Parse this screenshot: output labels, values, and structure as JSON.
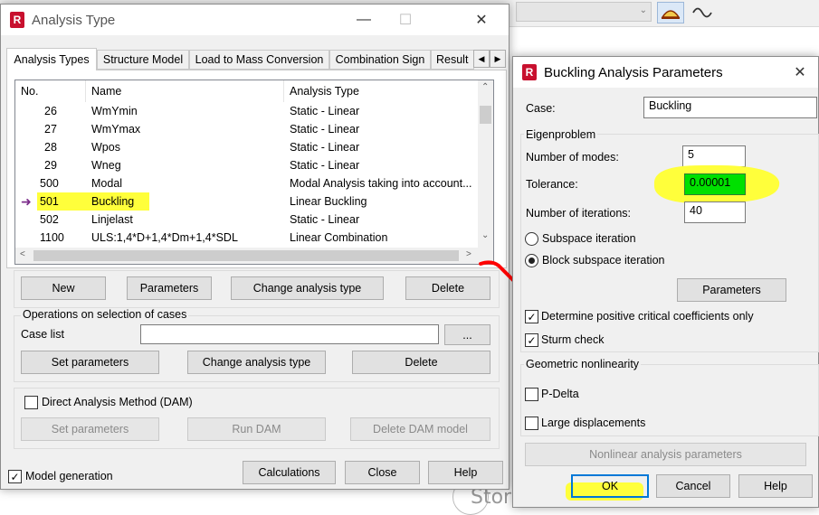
{
  "analysis_window": {
    "title": "Analysis Type",
    "tabs": [
      "Analysis Types",
      "Structure Model",
      "Load to Mass Conversion",
      "Combination Sign",
      "Result"
    ],
    "columns": [
      "No.",
      "Name",
      "Analysis Type"
    ],
    "rows": [
      {
        "no": "26",
        "name": "WmYmin",
        "type": "Static - Linear"
      },
      {
        "no": "27",
        "name": "WmYmax",
        "type": "Static - Linear"
      },
      {
        "no": "28",
        "name": "Wpos",
        "type": "Static - Linear"
      },
      {
        "no": "29",
        "name": "Wneg",
        "type": "Static - Linear"
      },
      {
        "no": "500",
        "name": "Modal",
        "type": "Modal Analysis taking into account..."
      },
      {
        "no": "501",
        "name": "Buckling",
        "type": "Linear Buckling"
      },
      {
        "no": "502",
        "name": "Linjelast",
        "type": "Static - Linear"
      },
      {
        "no": "1100",
        "name": "ULS:1,4*D+1,4*Dm+1,4*SDL",
        "type": "Linear Combination"
      }
    ],
    "selected_row": "501",
    "buttons": {
      "new": "New",
      "parameters": "Parameters",
      "change_type": "Change analysis type",
      "delete": "Delete"
    },
    "operations": {
      "title": "Operations on selection of cases",
      "case_list_label": "Case list",
      "case_list_value": "",
      "browse": "...",
      "set_parameters": "Set parameters",
      "change_type": "Change analysis type",
      "delete": "Delete"
    },
    "dam": {
      "label": "Direct Analysis Method (DAM)",
      "set_parameters": "Set parameters",
      "run": "Run DAM",
      "delete_model": "Delete DAM model"
    },
    "model_generation": "Model generation",
    "footer": {
      "calculations": "Calculations",
      "close": "Close",
      "help": "Help"
    }
  },
  "buckling_window": {
    "title": "Buckling Analysis Parameters",
    "case_label": "Case:",
    "case_value": "Buckling",
    "eigen_title": "Eigenproblem",
    "modes_label": "Number of modes:",
    "modes_value": "5",
    "tolerance_label": "Tolerance:",
    "tolerance_value": "0.00001",
    "iterations_label": "Number of iterations:",
    "iterations_value": "40",
    "subspace": "Subspace iteration",
    "block_subspace": "Block subspace iteration",
    "parameters": "Parameters",
    "positive_only": "Determine positive critical coefficients only",
    "sturm": "Sturm check",
    "geo_title": "Geometric nonlinearity",
    "pdelta": "P-Delta",
    "large_disp": "Large displacements",
    "nonlinear_params": "Nonlinear analysis parameters",
    "ok": "OK",
    "cancel": "Cancel",
    "help": "Help"
  },
  "colors": {
    "highlight": "#ffff3b",
    "tolerance_bg": "#00e000",
    "arrow": "#ff0000",
    "focus": "#0078d7"
  }
}
